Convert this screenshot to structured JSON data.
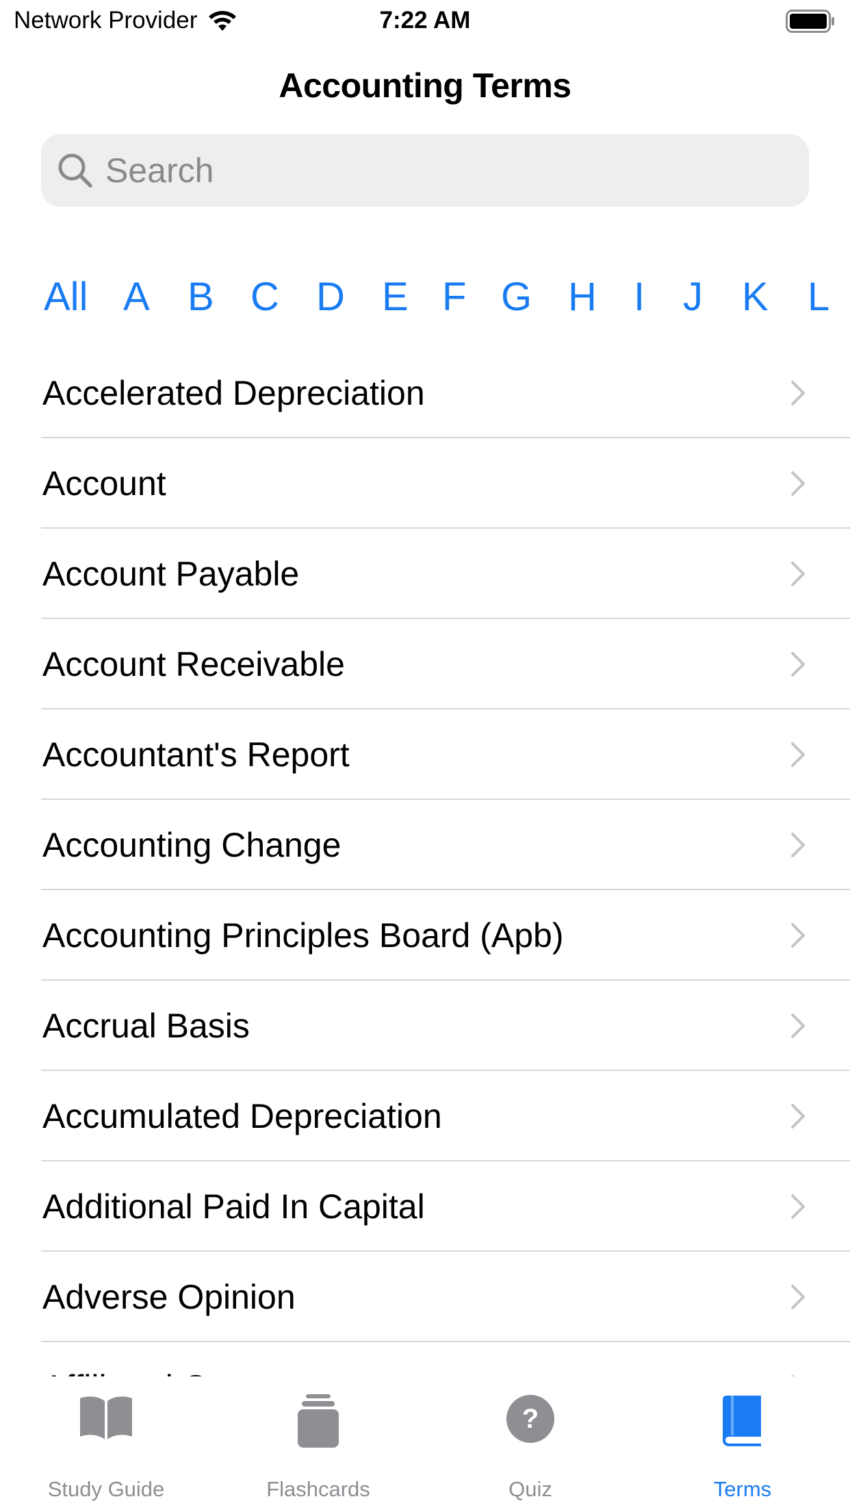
{
  "status_bar": {
    "carrier": "Network Provider",
    "time": "7:22 AM"
  },
  "nav": {
    "title": "Accounting Terms"
  },
  "search": {
    "placeholder": "Search",
    "value": ""
  },
  "letter_filter": {
    "selected": "All",
    "letters": [
      "All",
      "A",
      "B",
      "C",
      "D",
      "E",
      "F",
      "G",
      "H",
      "I",
      "J",
      "K",
      "L"
    ]
  },
  "terms": [
    "Accelerated Depreciation",
    "Account",
    "Account Payable",
    "Account Receivable",
    "Accountant's Report",
    "Accounting Change",
    "Accounting Principles Board (Apb)",
    "Accrual Basis",
    "Accumulated Depreciation",
    "Additional Paid In Capital",
    "Adverse Opinion",
    "Affiliated Company"
  ],
  "tab_bar": {
    "tabs": [
      {
        "label": "Study Guide",
        "icon": "book-open-icon",
        "active": false
      },
      {
        "label": "Flashcards",
        "icon": "flashcards-icon",
        "active": false
      },
      {
        "label": "Quiz",
        "icon": "question-circle-icon",
        "active": false
      },
      {
        "label": "Terms",
        "icon": "book-closed-icon",
        "active": true
      }
    ]
  },
  "colors": {
    "accent": "#1a7cf2",
    "inactive": "#8e8e93",
    "separator": "#d7d7da",
    "search_bg": "#eeeeef"
  }
}
